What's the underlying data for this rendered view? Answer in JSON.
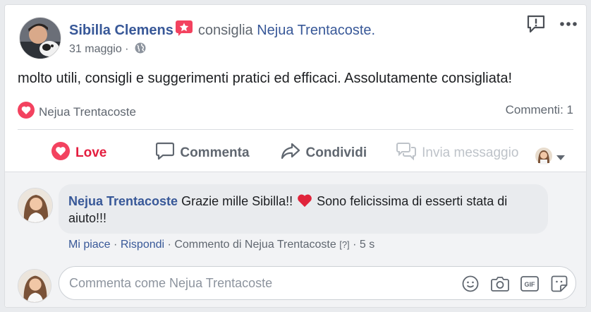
{
  "post": {
    "author": "Sibilla Clemens",
    "recommends_text": "consiglia",
    "page_name": "Nejua Trentacoste.",
    "date": "31 maggio",
    "separator": "·",
    "body": "molto utili, consigli e suggerimenti pratici ed efficaci. Assolutamente consigliata!",
    "reactor_name": "Nejua Trentacoste",
    "comments_count": "Commenti: 1"
  },
  "actions": {
    "love": "Love",
    "comment": "Commenta",
    "share": "Condividi",
    "message": "Invia messaggio"
  },
  "comment": {
    "author": "Nejua Trentacoste",
    "text_before_emoji": "Grazie mille Sibilla!!",
    "text_after_emoji": "Sono felicissima di esserti stata di aiuto!!!",
    "like": "Mi piace",
    "reply": "Rispondi",
    "by_line": "Commento di Nejua Trentacoste",
    "help_marker": "[?]",
    "time": "5 s",
    "dot": "·"
  },
  "composer": {
    "placeholder": "Commenta come Nejua Trentacoste"
  },
  "colors": {
    "link": "#385898",
    "love": "#e41e3f",
    "muted": "#606770",
    "background": "#e9ebee"
  },
  "icons": [
    "star-badge-icon",
    "globe-icon",
    "report-icon",
    "more-icon",
    "heart-icon",
    "comment-icon",
    "share-icon",
    "message-icon",
    "chevron-down-icon",
    "emoji-icon",
    "camera-icon",
    "gif-icon",
    "sticker-icon"
  ]
}
